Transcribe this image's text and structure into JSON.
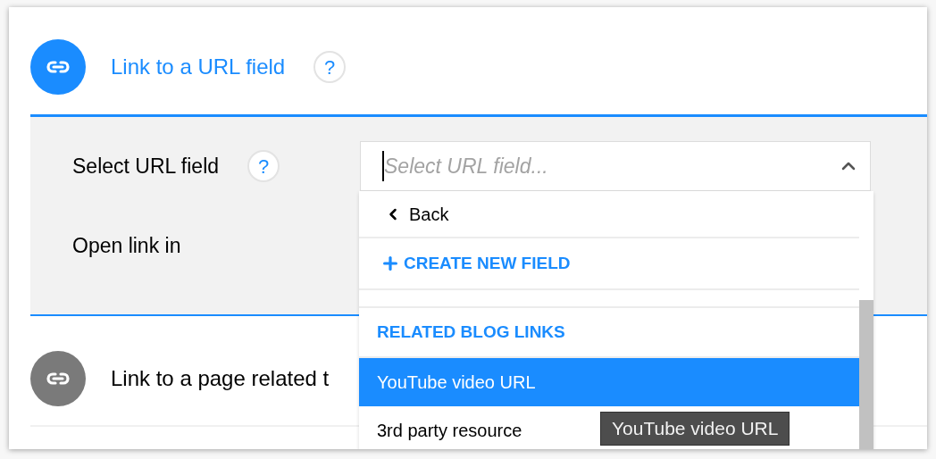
{
  "sections": [
    {
      "title": "Link to a URL field",
      "expanded": true,
      "help": "?",
      "fields": [
        {
          "label": "Select URL field",
          "help": "?"
        },
        {
          "label": "Open link in"
        }
      ]
    },
    {
      "title": "Link to a page related t",
      "expanded": false
    }
  ],
  "select": {
    "placeholder": "Select URL field...",
    "open": true
  },
  "dropdown": {
    "items": [
      {
        "kind": "back",
        "label": "Back"
      },
      {
        "kind": "action",
        "label": "CREATE NEW FIELD"
      },
      {
        "kind": "group",
        "label": "RELATED BLOG LINKS"
      },
      {
        "kind": "option",
        "label": "YouTube video URL",
        "selected": true
      },
      {
        "kind": "option",
        "label": "3rd party resource",
        "selected": false
      }
    ]
  },
  "tooltip": "YouTube video URL"
}
